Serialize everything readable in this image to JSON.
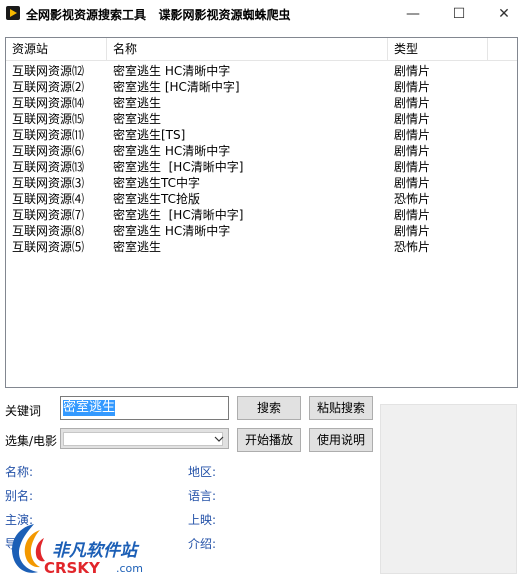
{
  "window": {
    "title": "全网影视资源搜索工具   谍影网影视资源蜘蛛爬虫",
    "minimize_symbol": "—",
    "maximize_symbol": "☐",
    "close_symbol": "✕"
  },
  "results": {
    "columns": [
      "资源站",
      "名称",
      "类型"
    ],
    "rows": [
      {
        "site": "互联网资源⑿",
        "name": "密室逃生 HC清晰中字",
        "type": "剧情片"
      },
      {
        "site": "互联网资源⑵",
        "name": "密室逃生 [HC清晰中字]",
        "type": "剧情片"
      },
      {
        "site": "互联网资源⒁",
        "name": "密室逃生",
        "type": "剧情片"
      },
      {
        "site": "互联网资源⒂",
        "name": "密室逃生",
        "type": "剧情片"
      },
      {
        "site": "互联网资源⑾",
        "name": "密室逃生[TS]",
        "type": "剧情片"
      },
      {
        "site": "互联网资源⑹",
        "name": "密室逃生 HC清晰中字",
        "type": "剧情片"
      },
      {
        "site": "互联网资源⒀",
        "name": "密室逃生  [HC清晰中字]",
        "type": "剧情片"
      },
      {
        "site": "互联网资源⑶",
        "name": "密室逃生TC中字",
        "type": "剧情片"
      },
      {
        "site": "互联网资源⑷",
        "name": "密室逃生TC抢版",
        "type": "恐怖片"
      },
      {
        "site": "互联网资源⑺",
        "name": "密室逃生  [HC清晰中字]",
        "type": "剧情片"
      },
      {
        "site": "互联网资源⑻",
        "name": "密室逃生 HC清晰中字",
        "type": "剧情片"
      },
      {
        "site": "互联网资源⑸",
        "name": "密室逃生",
        "type": "恐怖片"
      }
    ]
  },
  "search": {
    "keyword_label": "关键词",
    "keyword_value": "密室逃生",
    "episode_label": "选集/电影",
    "episode_value": ""
  },
  "buttons": {
    "search": "搜索",
    "paste_search": "粘贴搜索",
    "start_play": "开始播放",
    "instructions": "使用说明"
  },
  "info": {
    "name_label": "名称:",
    "region_label": "地区:",
    "alias_label": "别名:",
    "language_label": "语言:",
    "starring_label": "主演:",
    "release_label": "上映:",
    "director_label": "导",
    "intro_label": "介绍:"
  },
  "watermark": {
    "brand_cn": "非凡软件站",
    "brand_en": "CRSKY",
    "domain": ".com"
  },
  "colors": {
    "info_label": "#2452a8",
    "selection": "#3399ff",
    "button_face": "#e1e1e1",
    "watermark_blue": "#1c5fb6",
    "watermark_red": "#e1262b"
  }
}
